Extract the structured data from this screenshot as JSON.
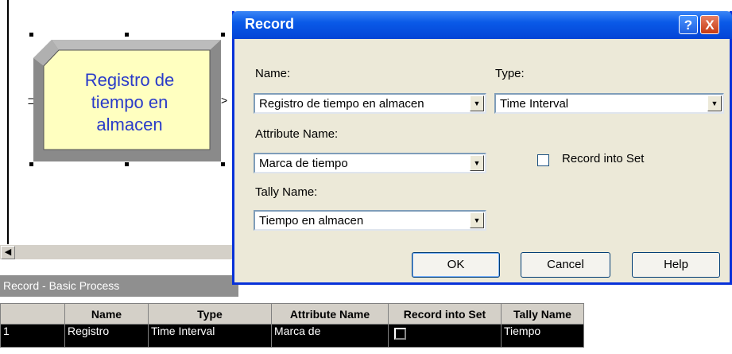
{
  "module": {
    "label_lines": [
      "Registro de",
      "tiempo en",
      "almacen"
    ]
  },
  "panel": {
    "title": "Record - Basic Process",
    "columns": [
      "Name",
      "Type",
      "Attribute Name",
      "Record into Set",
      "Tally Name"
    ],
    "rows": [
      {
        "num": "1",
        "name": "Registro",
        "type": "Time Interval",
        "attribute": "Marca de",
        "record_into_set": false,
        "tally": "Tiempo"
      }
    ]
  },
  "dialog": {
    "title": "Record",
    "help_glyph": "?",
    "close_glyph": "X",
    "name_label": "Name:",
    "name_value": "Registro de tiempo en almacen",
    "type_label": "Type:",
    "type_value": "Time Interval",
    "attribute_label": "Attribute Name:",
    "attribute_value": "Marca de tiempo",
    "record_into_set_label": "Record into Set",
    "record_into_set_checked": false,
    "tally_label": "Tally Name:",
    "tally_value": "Tiempo en almacen",
    "ok_label": "OK",
    "cancel_label": "Cancel",
    "help_label": "Help"
  },
  "colors": {
    "titlebar": "#0a5ae8",
    "module_fill": "#ffffc0",
    "module_text": "#2a3bc9"
  }
}
